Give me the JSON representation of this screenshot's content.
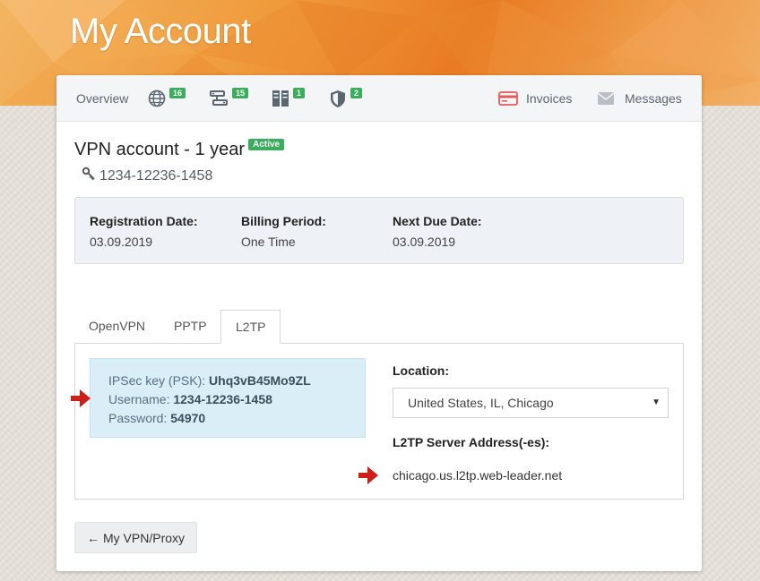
{
  "header": {
    "title": "My Account"
  },
  "nav": {
    "overview": "Overview",
    "counts": {
      "globe": "16",
      "servers": "15",
      "storage": "1",
      "shield": "2"
    },
    "invoices": "Invoices",
    "messages": "Messages"
  },
  "service": {
    "title": "VPN account - 1 year",
    "status": "Active",
    "account_key": "1234-12236-1458"
  },
  "details": {
    "registration_label": "Registration Date:",
    "registration_value": "03.09.2019",
    "billing_label": "Billing Period:",
    "billing_value": "One Time",
    "due_label": "Next Due Date:",
    "due_value": "03.09.2019"
  },
  "tabs": {
    "openvpn": "OpenVPN",
    "pptp": "PPTP",
    "l2tp": "L2TP",
    "active": "L2TP"
  },
  "credentials": {
    "psk_label": "IPSec key (PSK): ",
    "psk_value": "Uhq3vB45Mo9ZL",
    "username_label": "Username: ",
    "username_value": "1234-12236-1458",
    "password_label": "Password: ",
    "password_value": "54970"
  },
  "location": {
    "label": "Location:",
    "selected": "United States, IL, Chicago",
    "caret": "▼"
  },
  "server": {
    "label": "L2TP Server Address(-es):",
    "address": "chicago.us.l2tp.web-leader.net"
  },
  "back_button": {
    "label": "My VPN/Proxy",
    "icon": "←"
  },
  "colors": {
    "badge_green": "#3aae5c",
    "arrow_red": "#cc1f1a",
    "accent_orange": "#e97b22"
  }
}
